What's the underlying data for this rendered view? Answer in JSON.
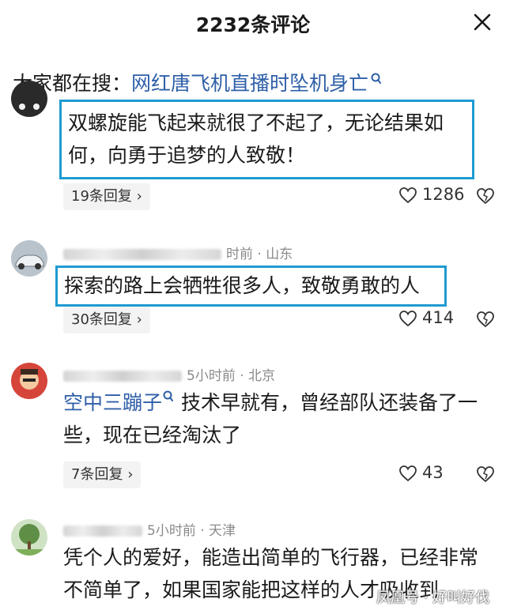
{
  "header": {
    "title": "2232条评论"
  },
  "hot_search": {
    "label": "大家都在搜：",
    "query": "网红唐飞机直播时坠机身亡"
  },
  "comments": [
    {
      "text": "双螺旋能飞起来就很了不起了，无论结果如何，向勇于追梦的人致敬！",
      "reply_label": "19条回复",
      "likes": "1286"
    },
    {
      "meta": "时前 · 山东",
      "text": "探索的路上会牺牲很多人，致敬勇敢的人",
      "reply_label": "30条回复",
      "likes": "414"
    },
    {
      "meta": "5小时前 · 北京",
      "topic": "空中三蹦子",
      "text": " 技术早就有，曾经部队还装备了一些，现在已经淘汰了",
      "reply_label": "7条回复",
      "likes": "43"
    },
    {
      "meta": "5小时前 · 天津",
      "text": "凭个人的爱好，能造出简单的飞行器，已经非常不简单了，如果国家能把这样的人才吸收到"
    }
  ],
  "watermark": "凤凰号 · 好叫好伐"
}
